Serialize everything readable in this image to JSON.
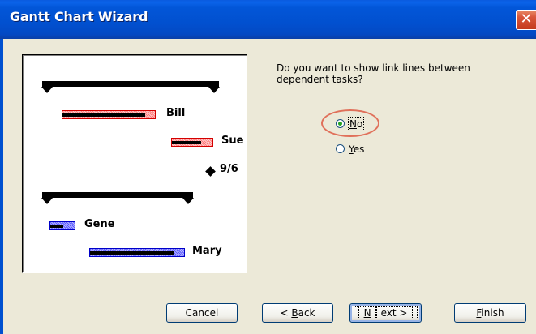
{
  "window": {
    "title": "Gantt Chart Wizard",
    "close_glyph": "✕"
  },
  "preview": {
    "tasks": [
      {
        "name": "Bill",
        "color": "#FF0000"
      },
      {
        "name": "Sue",
        "color": "#FF0000"
      },
      {
        "name": "Gene",
        "color": "#0000FF"
      },
      {
        "name": "Mary",
        "color": "#0000FF"
      }
    ],
    "milestone": {
      "label": "9/6",
      "icon": "diamond-icon"
    }
  },
  "question": "Do you want to show link lines between dependent tasks?",
  "options": [
    {
      "label": "No",
      "access_key": "N",
      "rest": "o",
      "selected": true
    },
    {
      "label": "Yes",
      "access_key": "Y",
      "rest": "es",
      "selected": false
    }
  ],
  "buttons": {
    "cancel": "Cancel",
    "back": {
      "prefix": "< ",
      "access_key": "B",
      "rest": "ack"
    },
    "next": {
      "access_key": "N",
      "rest": "ext >"
    },
    "finish": {
      "access_key": "F",
      "rest": "inish"
    }
  },
  "colors": {
    "titlebar": "#0150CF",
    "dialog_bg": "#ECE9D8",
    "highlight_circle": "#E0705A",
    "radio_dot": "#21A121"
  }
}
